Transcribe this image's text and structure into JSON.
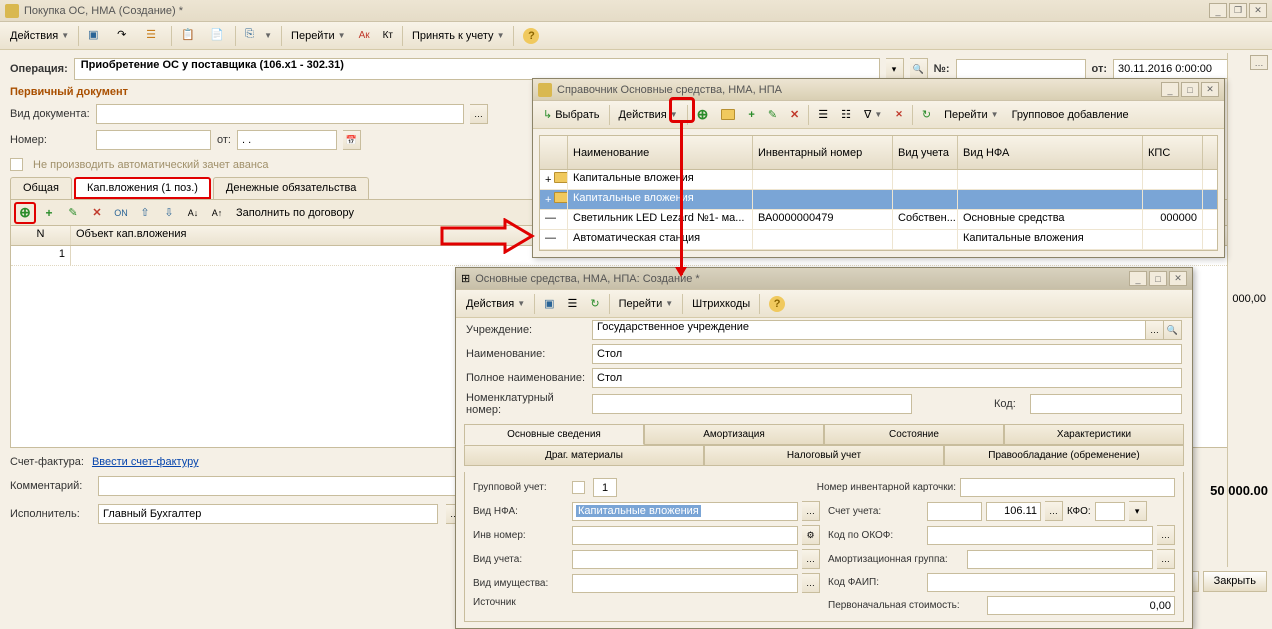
{
  "main_window": {
    "title": "Покупка ОС, НМА (Создание) *",
    "toolbar": {
      "actions": "Действия",
      "goto": "Перейти",
      "accept": "Принять к учету"
    },
    "operation_label": "Операция:",
    "operation_value": "Приобретение ОС у поставщика (106.x1 - 302.31)",
    "num_label": "№:",
    "from_label": "от:",
    "date_value": "30.11.2016 0:00:00",
    "primary_doc": "Первичный документ",
    "doc_type": "Вид документа:",
    "number": "Номер:",
    "from2": "от:",
    "date2": ". .",
    "advance_check": "Не производить автоматический зачет аванса",
    "tabs": {
      "common": "Общая",
      "kap": "Кап.вложения (1 поз.)",
      "money": "Денежные обязательства"
    },
    "fill_contract": "Заполнить по договору",
    "grid_head": {
      "n": "N",
      "obj": "Объект кап.вложения"
    },
    "grid_rows": [
      {
        "n": "1",
        "obj": ""
      }
    ],
    "invoice_lbl": "Счет-фактура:",
    "invoice_link": "Ввести счет-фактуру",
    "comment": "Комментарий:",
    "executor": "Исполнитель:",
    "executor_val": "Главный Бухгалтер",
    "right_nums": {
      "zero": "000,00",
      "total": "50 000.00"
    },
    "close_btn": "Закрыть"
  },
  "ref_window": {
    "title": "Справочник Основные средства, НМА, НПА",
    "select": "Выбрать",
    "actions": "Действия",
    "goto": "Перейти",
    "group_add": "Групповое добавление",
    "columns": {
      "name": "Наименование",
      "inv": "Инвентарный номер",
      "acc": "Вид учета",
      "nfa": "Вид НФА",
      "kps": "КПС"
    },
    "rows": [
      {
        "icon": "folder",
        "name": "Капитальные вложения",
        "inv": "",
        "acc": "",
        "nfa": "",
        "kps": ""
      },
      {
        "icon": "folder",
        "name": "Капитальные вложения",
        "inv": "",
        "acc": "",
        "nfa": "",
        "kps": "",
        "selected": true
      },
      {
        "icon": "item",
        "name": "Светильник LED Lezard №1- ма...",
        "inv": "ВА0000000479",
        "acc": "Собствен...",
        "nfa": "Основные средства",
        "kps": "000000"
      },
      {
        "icon": "item",
        "name": "Автоматическая станция",
        "inv": "",
        "acc": "",
        "nfa": "Капитальные вложения",
        "kps": ""
      }
    ]
  },
  "create_window": {
    "title": "Основные средства, НМА, НПА: Создание *",
    "actions": "Действия",
    "goto": "Перейти",
    "barcodes": "Штрихкоды",
    "institution_lbl": "Учреждение:",
    "institution_val": "Государственное учреждение",
    "name_lbl": "Наименование:",
    "name_val": "Стол",
    "fullname_lbl": "Полное наименование:",
    "fullname_val": "Стол",
    "nomen_lbl": "Номенклатурный номер:",
    "code_lbl": "Код:",
    "tabs_top": {
      "main": "Основные сведения",
      "amort": "Амортизация",
      "state": "Состояние",
      "char": "Характеристики"
    },
    "tabs_bot": {
      "drag": "Драг. материалы",
      "tax": "Налоговый учет",
      "rights": "Правообладание (обременение)"
    },
    "group_acc": "Групповой учет:",
    "grp_val": "1",
    "inv_card": "Номер инвентарной карточки:",
    "vid_nfa": "Вид НФА:",
    "vid_nfa_val": "Капитальные вложения",
    "acc": "Счет учета:",
    "acc_val": "106.11",
    "kfo": "КФО:",
    "inv_num": "Инв номер:",
    "okof": "Код по ОКОФ:",
    "vid_uch": "Вид учета:",
    "amort_grp": "Амортизационная группа:",
    "vid_im": "Вид имущества:",
    "faip": "Код ФАИП:",
    "source": "Источник",
    "init_cost": "Первоначальная стоимость:",
    "cost_val": "0,00"
  }
}
